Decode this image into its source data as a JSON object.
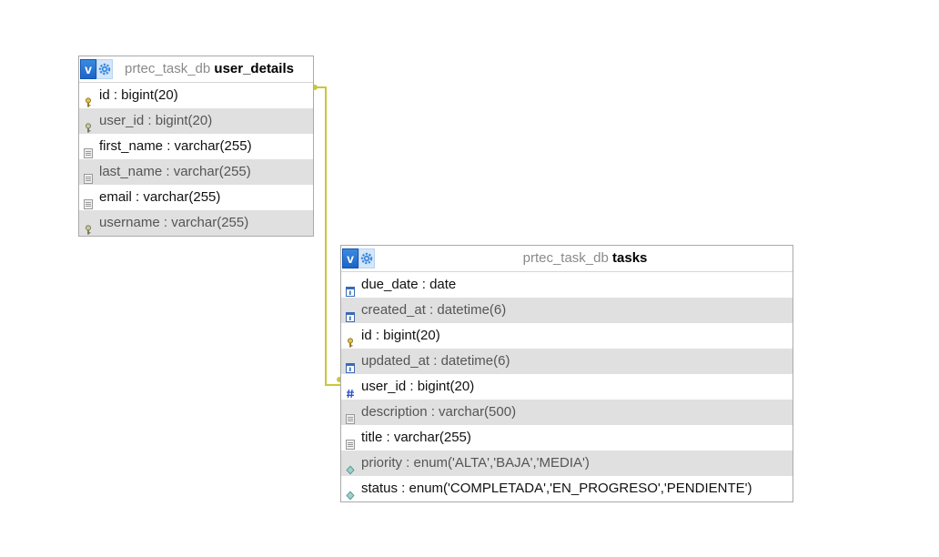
{
  "colors": {
    "relation_line": "#c8c83a",
    "row_alt": "#e0e0e0",
    "header_toggle": "#1c64c8"
  },
  "tables": {
    "user_details": {
      "toggle_label": "v",
      "db": "prtec_task_db",
      "name": "user_details",
      "columns": [
        {
          "text": "id : bigint(20)",
          "icon": "primary-key-icon"
        },
        {
          "text": "user_id : bigint(20)",
          "icon": "unique-key-icon"
        },
        {
          "text": "first_name : varchar(255)",
          "icon": "text-field-icon"
        },
        {
          "text": "last_name : varchar(255)",
          "icon": "text-field-icon"
        },
        {
          "text": "email : varchar(255)",
          "icon": "text-field-icon"
        },
        {
          "text": "username : varchar(255)",
          "icon": "unique-key-icon"
        }
      ]
    },
    "tasks": {
      "toggle_label": "v",
      "db": "prtec_task_db",
      "name": "tasks",
      "columns": [
        {
          "text": "due_date : date",
          "icon": "date-icon"
        },
        {
          "text": "created_at : datetime(6)",
          "icon": "date-icon"
        },
        {
          "text": "id : bigint(20)",
          "icon": "primary-key-icon"
        },
        {
          "text": "updated_at : datetime(6)",
          "icon": "date-icon"
        },
        {
          "text": "user_id : bigint(20)",
          "icon": "numeric-hash-icon"
        },
        {
          "text": "description : varchar(500)",
          "icon": "text-field-icon"
        },
        {
          "text": "title : varchar(255)",
          "icon": "text-field-icon"
        },
        {
          "text": "priority : enum('ALTA','BAJA','MEDIA')",
          "icon": "enum-icon"
        },
        {
          "text": "status : enum('COMPLETADA','EN_PROGRESO','PENDIENTE')",
          "icon": "enum-icon"
        }
      ]
    }
  }
}
